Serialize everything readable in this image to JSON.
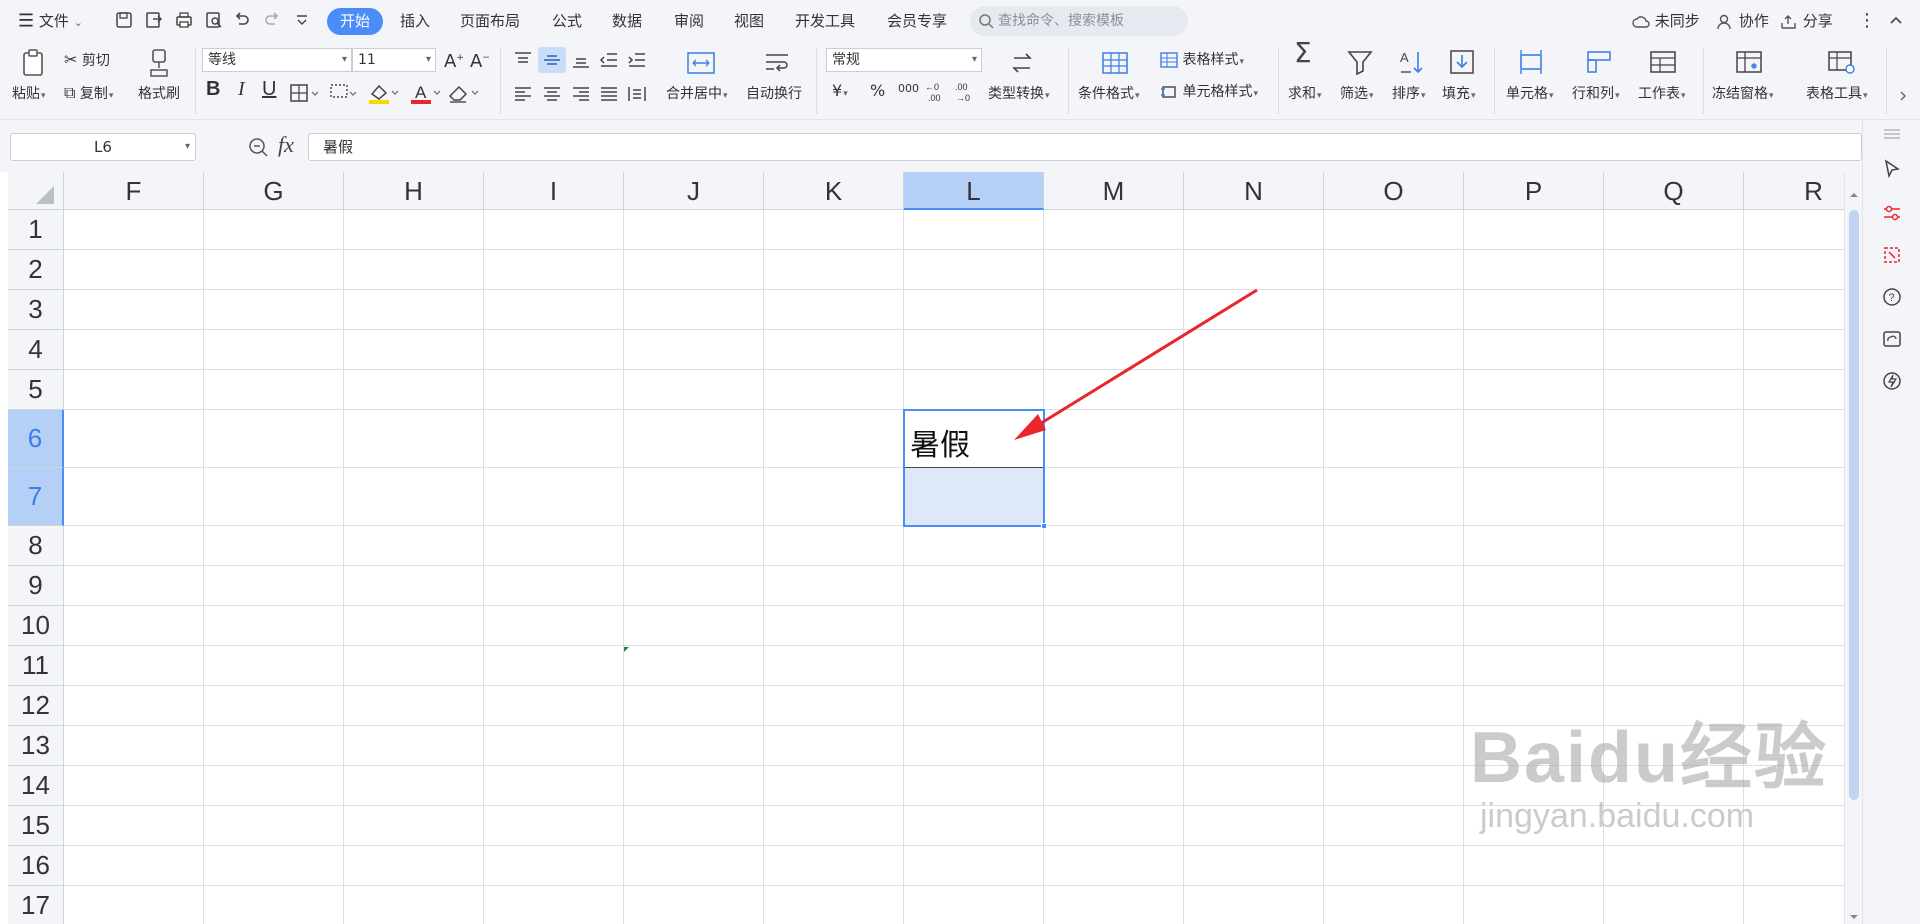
{
  "menubar": {
    "file_label": "文件",
    "tabs": [
      "开始",
      "插入",
      "页面布局",
      "公式",
      "数据",
      "审阅",
      "视图",
      "开发工具",
      "会员专享"
    ],
    "search_placeholder": "查找命令、搜索模板",
    "sync_label": "未同步",
    "collab_label": "协作",
    "share_label": "分享"
  },
  "ribbon": {
    "paste": "粘贴",
    "cut": "剪切",
    "copy": "复制",
    "format_painter": "格式刷",
    "font_name": "等线",
    "font_size": "11",
    "merge_center": "合并居中",
    "wrap_text": "自动换行",
    "number_format": "常规",
    "currency_symbol": "¥",
    "percent_symbol": "%",
    "thousands_symbol": "000",
    "type_convert": "类型转换",
    "conditional_format": "条件格式",
    "table_style": "表格样式",
    "cell_style": "单元格样式",
    "sum": "求和",
    "filter": "筛选",
    "sort": "排序",
    "fill": "填充",
    "cell": "单元格",
    "row_col": "行和列",
    "worksheet": "工作表",
    "freeze": "冻结窗格",
    "table_tools": "表格工具"
  },
  "formula_bar": {
    "cell_ref": "L6",
    "fx_label": "fx",
    "formula_value": "暑假"
  },
  "sheet": {
    "columns": [
      "F",
      "G",
      "H",
      "I",
      "J",
      "K",
      "L",
      "M",
      "N",
      "O",
      "P",
      "Q",
      "R"
    ],
    "rows": [
      "1",
      "2",
      "3",
      "4",
      "5",
      "6",
      "7",
      "8",
      "9",
      "10",
      "11",
      "12",
      "13",
      "14",
      "15",
      "16",
      "17"
    ],
    "selected_column": "L",
    "selected_rows": [
      "6",
      "7"
    ],
    "cell_L6": "暑假"
  },
  "watermark": {
    "brand": "Baidu经验",
    "url": "jingyan.baidu.com"
  },
  "colors": {
    "accent": "#4b8df8",
    "arrow": "#e8262b",
    "header_bg": "#f3f5f9"
  }
}
